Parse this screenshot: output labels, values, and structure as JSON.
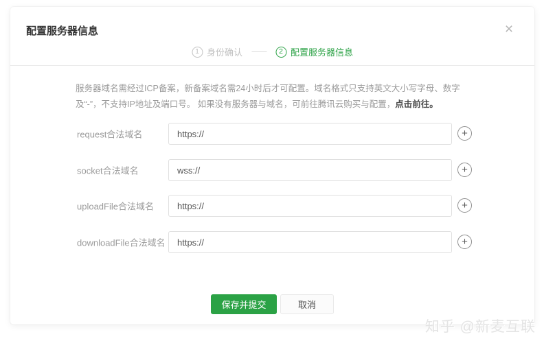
{
  "dialog": {
    "title": "配置服务器信息",
    "close_icon": "×"
  },
  "steps": {
    "step1": {
      "number": "1",
      "label": "身份确认"
    },
    "step2": {
      "number": "2",
      "label": "配置服务器信息"
    }
  },
  "notice": {
    "text": "服务器域名需经过ICP备案，新备案域名需24小时后才可配置。域名格式只支持英文大小写字母、数字及“-”，不支持IP地址及端口号。 如果没有服务器与域名，可前往腾讯云购买与配置，",
    "link": "点击前往。"
  },
  "form": {
    "add_icon": "+",
    "fields": [
      {
        "label": "request合法域名",
        "value": "https://"
      },
      {
        "label": "socket合法域名",
        "value": "wss://"
      },
      {
        "label": "uploadFile合法域名",
        "value": "https://"
      },
      {
        "label": "downloadFile合法域名",
        "value": "https://"
      }
    ]
  },
  "actions": {
    "submit": "保存并提交",
    "cancel": "取消"
  },
  "watermark": "知乎 @新麦互联",
  "colors": {
    "accent_green": "#2ba245",
    "muted_text": "#9b9b9b"
  }
}
